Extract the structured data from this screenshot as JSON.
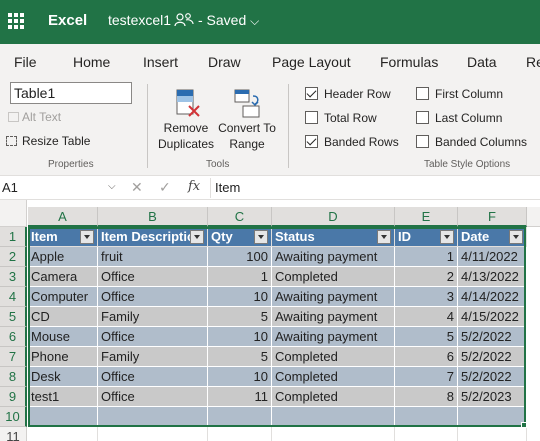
{
  "titlebar": {
    "app_name": "Excel",
    "doc_name": "testexcel1",
    "saved_status": "- Saved",
    "chevron": "⌵",
    "icons": [
      "waffle-icon",
      "people-icon",
      "chevron-down-icon"
    ]
  },
  "ribbon_tabs": [
    "File",
    "Home",
    "Insert",
    "Draw",
    "Page Layout",
    "Formulas",
    "Data",
    "Re"
  ],
  "properties": {
    "table_name_value": "Table1",
    "alt_text_label": "Alt Text",
    "resize_label": "Resize Table",
    "group_label": "Properties"
  },
  "tools": {
    "remove_duplicates_line1": "Remove",
    "remove_duplicates_line2": "Duplicates",
    "convert_line1": "Convert To",
    "convert_line2": "Range",
    "group_label": "Tools"
  },
  "style_options": {
    "header_row": {
      "label": "Header Row",
      "checked": true
    },
    "total_row": {
      "label": "Total Row",
      "checked": false
    },
    "banded_rows": {
      "label": "Banded Rows",
      "checked": true
    },
    "first_column": {
      "label": "First Column",
      "checked": false
    },
    "last_column": {
      "label": "Last Column",
      "checked": false
    },
    "banded_columns": {
      "label": "Banded Columns",
      "checked": false
    },
    "group_label": "Table Style Options"
  },
  "formula_bar": {
    "name_box": "A1",
    "cancel_glyph": "✕",
    "enter_glyph": "✓",
    "fx_label": "fx",
    "value": "Item"
  },
  "columns": [
    "A",
    "B",
    "C",
    "D",
    "E",
    "F"
  ],
  "rows": [
    "1",
    "2",
    "3",
    "4",
    "5",
    "6",
    "7",
    "8",
    "9",
    "10",
    "11"
  ],
  "table": {
    "headers": [
      "Item",
      "Item Description",
      "Qty",
      "Status",
      "ID",
      "Date"
    ],
    "data": [
      [
        "Apple",
        "fruit",
        "100",
        "Awaiting payment",
        "1",
        "4/11/2022"
      ],
      [
        "Camera",
        "Office",
        "1",
        "Completed",
        "2",
        "4/13/2022"
      ],
      [
        "Computer",
        "Office",
        "10",
        "Awaiting payment",
        "3",
        "4/14/2022"
      ],
      [
        "CD",
        "Family",
        "5",
        "Awaiting payment",
        "4",
        "4/15/2022"
      ],
      [
        "Mouse",
        "Office",
        "10",
        "Awaiting payment",
        "5",
        "5/2/2022"
      ],
      [
        "Phone",
        "Family",
        "5",
        "Completed",
        "6",
        "5/2/2022"
      ],
      [
        "Desk",
        "Office",
        "10",
        "Completed",
        "7",
        "5/2/2022"
      ],
      [
        "test1",
        "Office",
        "11",
        "Completed",
        "8",
        "5/2/2023"
      ]
    ]
  },
  "colors": {
    "brand_green": "#217346",
    "table_header": "#4a78a8",
    "band_1": "#b0bdcb",
    "band_2": "#c9c9c9"
  }
}
